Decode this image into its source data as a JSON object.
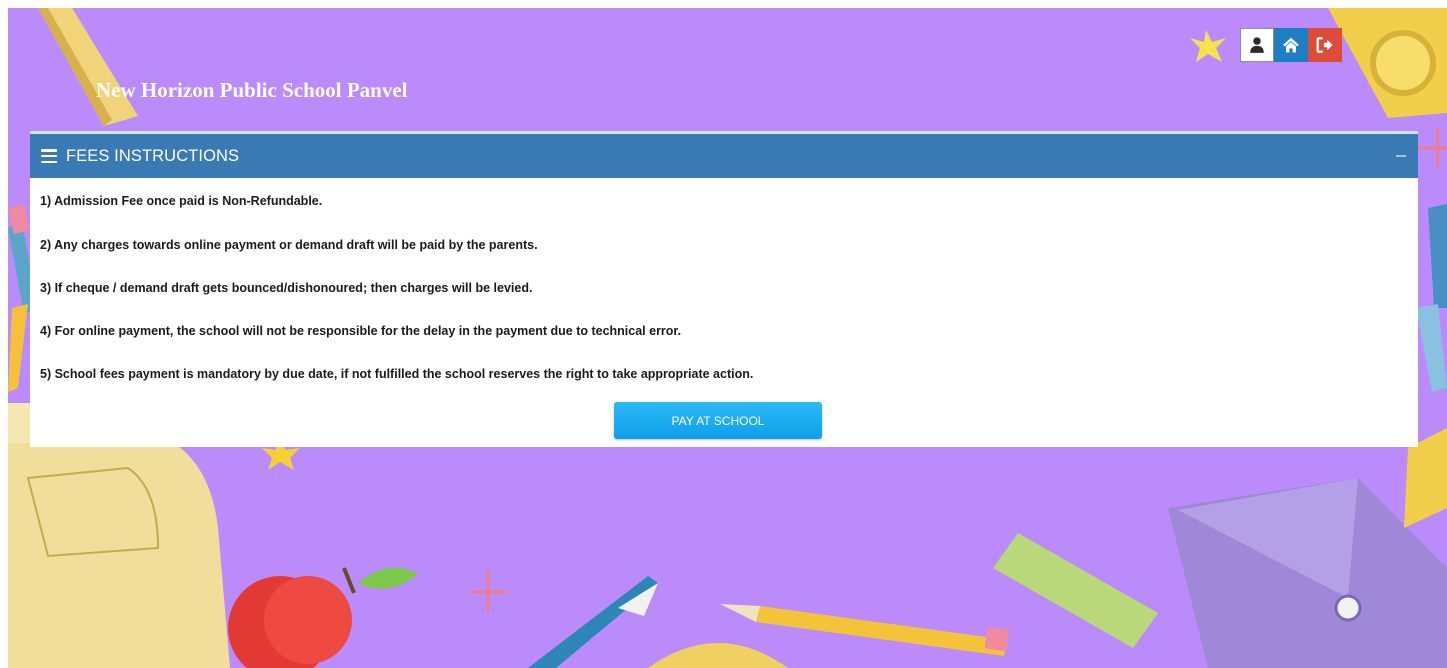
{
  "school": {
    "name": "New Horizon Public School Panvel"
  },
  "top_actions": [
    {
      "icon": "user-icon"
    },
    {
      "icon": "home-icon"
    },
    {
      "icon": "sign-out-icon"
    }
  ],
  "panel": {
    "title": "FEES INSTRUCTIONS",
    "instructions": [
      "1) Admission Fee once paid is Non-Refundable.",
      "2) Any charges towards online payment or demand draft will be paid by the parents.",
      "3) If cheque / demand draft gets bounced/dishonoured; then charges will be levied.",
      "4) For online payment, the school will not be responsible for the delay in the payment due to technical error.",
      "5) School fees payment is mandatory by due date, if not fulfilled the school reserves the right to take appropriate action."
    ],
    "pay_button_label": "PAY AT SCHOOL"
  },
  "colors": {
    "background": "#bc8bfb",
    "panel_header": "#3a7ab4",
    "home_button": "#1f7ec2",
    "logout_button": "#dd4b39",
    "pay_button": "#1aaaf0"
  }
}
